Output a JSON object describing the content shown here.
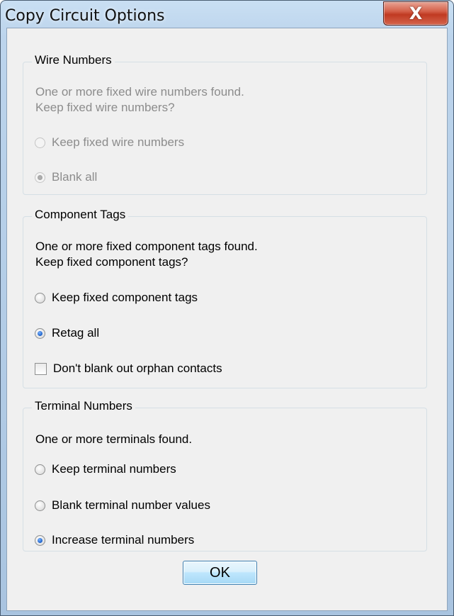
{
  "window": {
    "title": "Copy Circuit Options",
    "close_glyph": "X"
  },
  "wire_numbers": {
    "title": "Wire Numbers",
    "enabled": false,
    "message_line1": "One or more fixed wire numbers found.",
    "message_line2": "Keep fixed wire numbers?",
    "options": [
      {
        "label": "Keep fixed wire numbers",
        "checked": false
      },
      {
        "label": "Blank all",
        "checked": true
      }
    ]
  },
  "component_tags": {
    "title": "Component Tags",
    "enabled": true,
    "message_line1": "One or more fixed component tags found.",
    "message_line2": "Keep fixed component tags?",
    "options": [
      {
        "label": "Keep fixed component tags",
        "checked": false
      },
      {
        "label": "Retag all",
        "checked": true
      }
    ],
    "checkbox": {
      "label": "Don't blank out orphan contacts",
      "checked": false
    }
  },
  "terminal_numbers": {
    "title": "Terminal Numbers",
    "enabled": true,
    "message": "One or more terminals found.",
    "options": [
      {
        "label": "Keep terminal numbers",
        "checked": false
      },
      {
        "label": "Blank terminal number values",
        "checked": false
      },
      {
        "label": "Increase terminal numbers",
        "checked": true
      }
    ]
  },
  "buttons": {
    "ok_label": "OK"
  }
}
